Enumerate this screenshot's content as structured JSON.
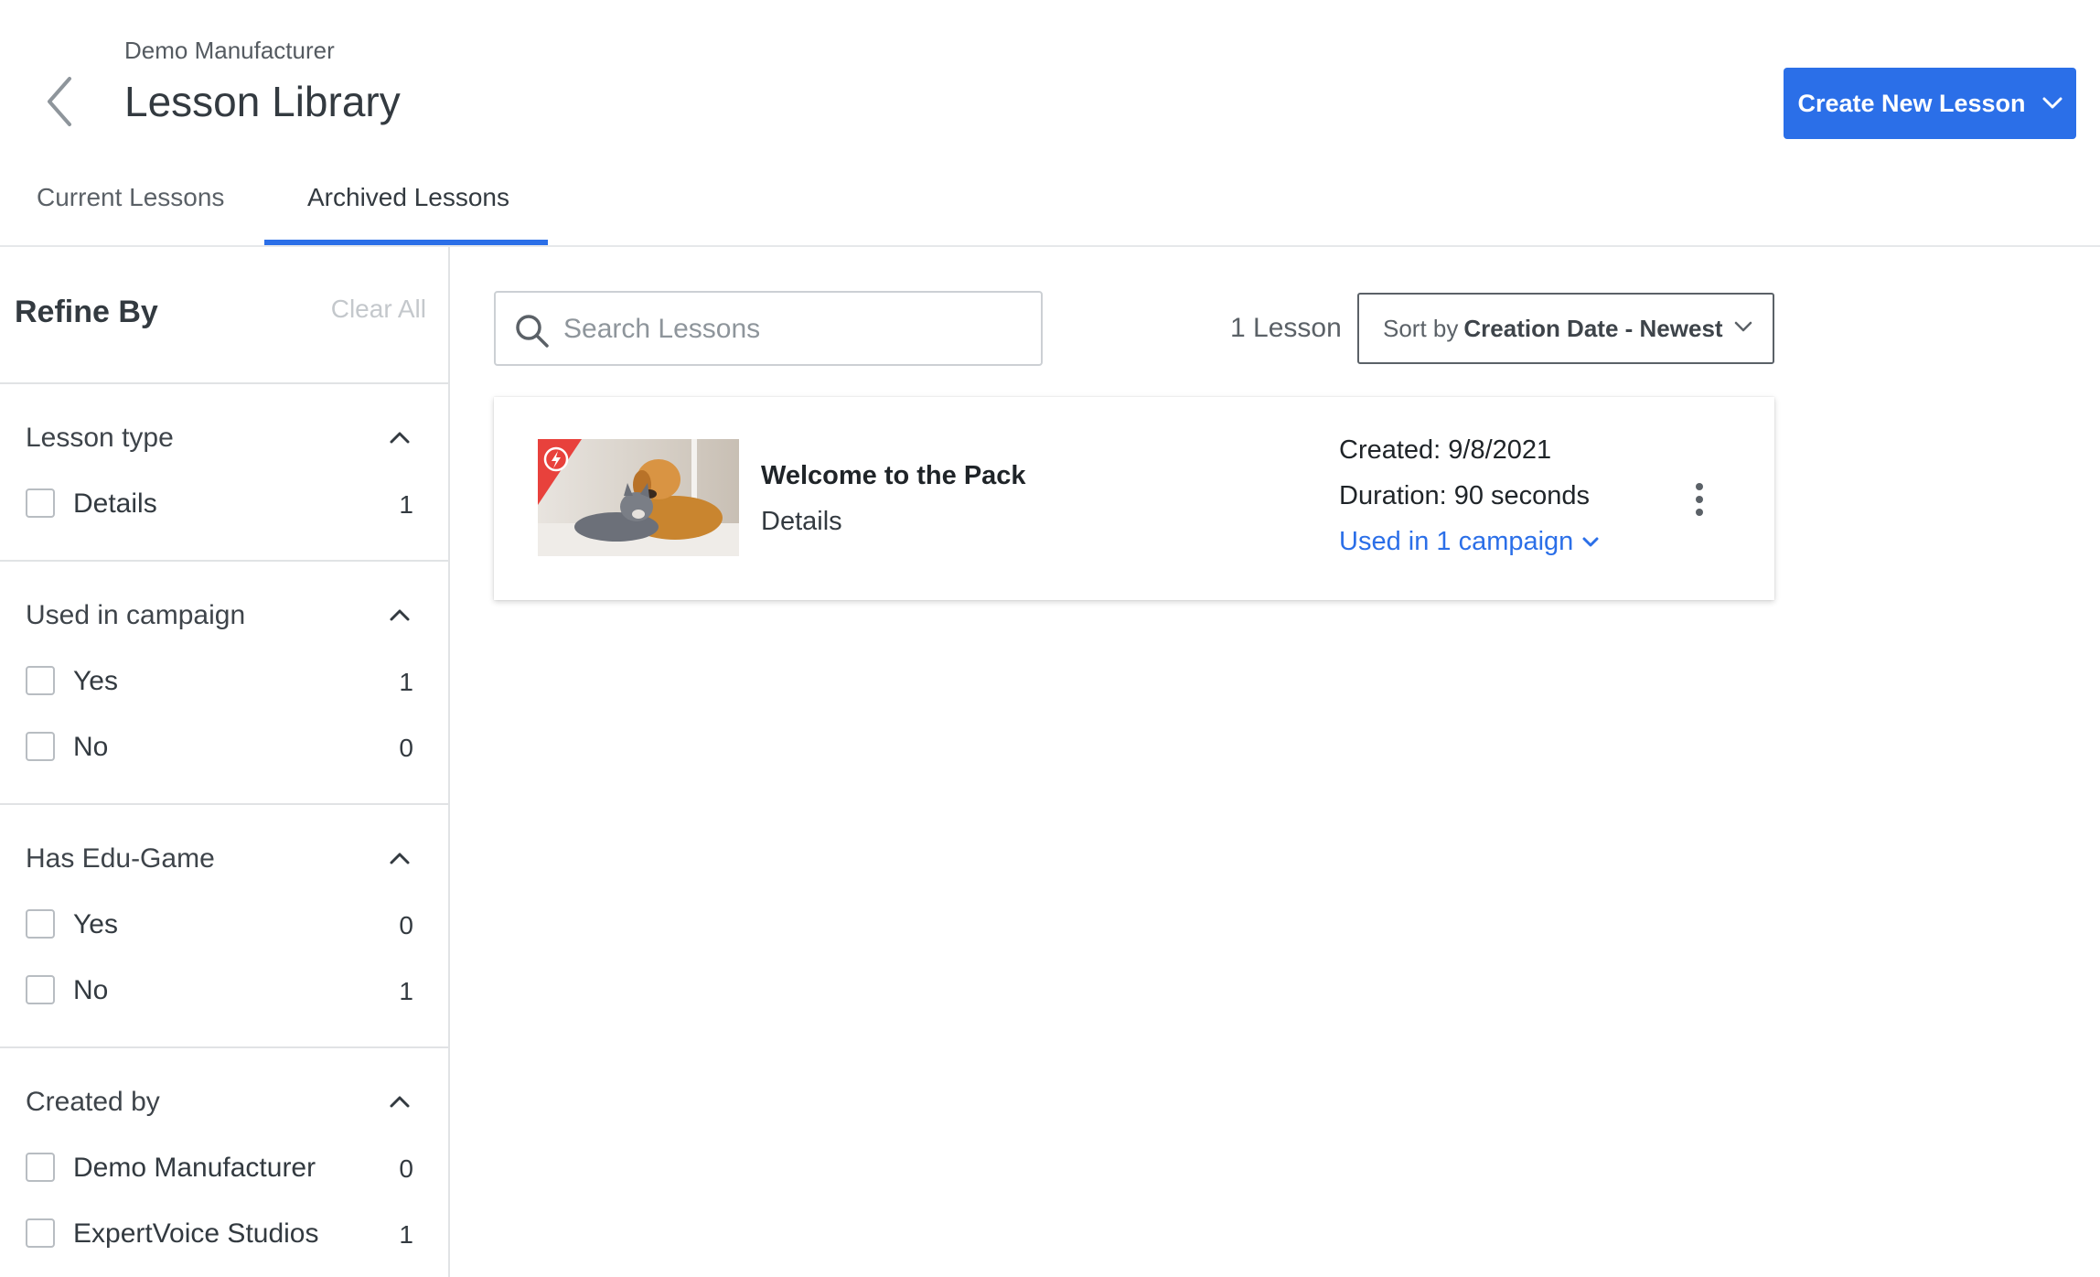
{
  "header": {
    "org_name": "Demo Manufacturer",
    "title": "Lesson Library",
    "create_button": "Create New Lesson"
  },
  "tabs": [
    {
      "label": "Current Lessons",
      "active": false
    },
    {
      "label": "Archived Lessons",
      "active": true
    }
  ],
  "sidebar": {
    "title": "Refine By",
    "clear_all": "Clear All",
    "sections": [
      {
        "title": "Lesson type",
        "options": [
          {
            "label": "Details",
            "count": "1"
          }
        ]
      },
      {
        "title": "Used in campaign",
        "options": [
          {
            "label": "Yes",
            "count": "1"
          },
          {
            "label": "No",
            "count": "0"
          }
        ]
      },
      {
        "title": "Has Edu-Game",
        "options": [
          {
            "label": "Yes",
            "count": "0"
          },
          {
            "label": "No",
            "count": "1"
          }
        ]
      },
      {
        "title": "Created by",
        "options": [
          {
            "label": "Demo Manufacturer",
            "count": "0"
          },
          {
            "label": "ExpertVoice Studios",
            "count": "1"
          }
        ]
      }
    ]
  },
  "search": {
    "placeholder": "Search Lessons"
  },
  "results": {
    "count_text": "1 Lesson",
    "sort_prefix": "Sort by",
    "sort_value": "Creation Date - Newest"
  },
  "lessons": [
    {
      "title": "Welcome to the Pack",
      "type": "Details",
      "created": "Created: 9/8/2021",
      "duration": "Duration: 90 seconds",
      "campaign_link": "Used in 1 campaign"
    }
  ],
  "colors": {
    "accent": "#2b6fe8",
    "badge": "#e8413c"
  },
  "icons": [
    "back-arrow-icon",
    "chevron-down-icon",
    "chevron-up-icon",
    "search-icon",
    "lightning-badge-icon",
    "kebab-menu-icon"
  ]
}
